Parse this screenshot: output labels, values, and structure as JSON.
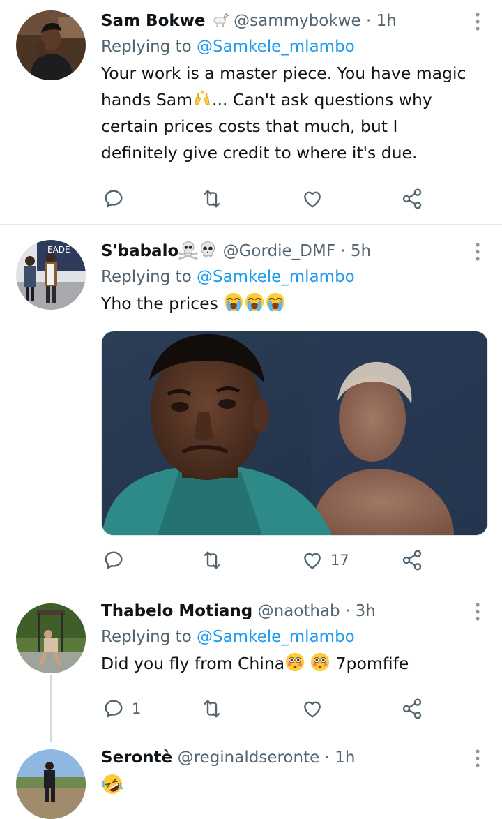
{
  "replying_label": "Replying to",
  "tweets": [
    {
      "name": "Sam Bokwe",
      "handle": "@sammybokwe",
      "time": "1h",
      "reply_to": "@Samkele_mlambo",
      "text_lines": [
        "Your work is a master piece. You have magic",
        "hands Sam",
        "... Can't ask questions why",
        "certain prices costs that much, but I",
        "definitely give credit to where it's due."
      ],
      "badge_icon": "goat-emoji-icon",
      "inline_icon": "raising-hands-emoji-icon"
    },
    {
      "name": "S'babalo",
      "handle": "@Gordie_DMF",
      "time": "5h",
      "reply_to": "@Samkele_mlambo",
      "text": "Yho the prices",
      "name_icons": [
        "skull-crossbones-emoji-icon",
        "skull-emoji-icon"
      ],
      "text_icons": [
        "loudly-crying-emoji-icon",
        "loudly-crying-emoji-icon",
        "loudly-crying-emoji-icon"
      ],
      "like_count": "17"
    },
    {
      "name": "Thabelo Motiang",
      "handle": "@naothab",
      "time": "3h",
      "reply_to": "@Samkele_mlambo",
      "text_before": "Did you fly from China",
      "text_after": "7pomfife",
      "text_icons": [
        "flushed-face-emoji-icon",
        "flushed-face-emoji-icon"
      ],
      "reply_count": "1"
    },
    {
      "name": "Serontè",
      "handle": "@reginaldseronte",
      "time": "1h",
      "text_icon": "rolling-on-floor-laughing-emoji-icon"
    }
  ],
  "colors": {
    "link": "#1d9bf0",
    "secondary_text": "#536471",
    "primary_text": "#0f1419",
    "divider": "#e1e8ed"
  }
}
